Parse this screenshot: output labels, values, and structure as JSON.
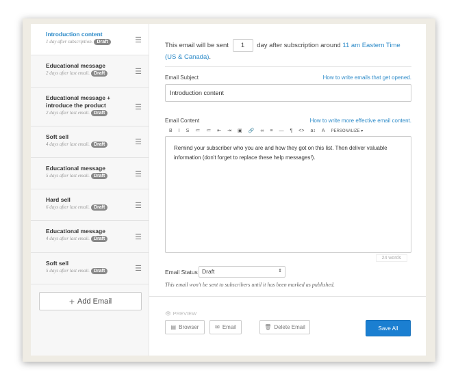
{
  "sidebar": {
    "items": [
      {
        "title": "Introduction content",
        "sub": "1 day after subscription.",
        "badge": "Draft"
      },
      {
        "title": "Educational message",
        "sub": "2 days after last email.",
        "badge": "Draft"
      },
      {
        "title": "Educational message + introduce the product",
        "sub": "2 days after last email.",
        "badge": "Draft"
      },
      {
        "title": "Soft sell",
        "sub": "4 days after last email.",
        "badge": "Draft"
      },
      {
        "title": "Educational message",
        "sub": "5 days after last email.",
        "badge": "Draft"
      },
      {
        "title": "Hard sell",
        "sub": "6 days after last email.",
        "badge": "Draft"
      },
      {
        "title": "Educational message",
        "sub": "4 days after last email.",
        "badge": "Draft"
      },
      {
        "title": "Soft sell",
        "sub": "5 days after last email.",
        "badge": "Draft"
      }
    ],
    "add_label": "Add Email"
  },
  "schedule": {
    "prefix": "This email will be sent",
    "days": "1",
    "middle": "day after subscription around",
    "time_link": "11 am Eastern Time (US & Canada)",
    "suffix": "."
  },
  "subject": {
    "label": "Email Subject",
    "help": "How to write emails that get opened.",
    "value": "Introduction content"
  },
  "content": {
    "label": "Email Content",
    "help": "How to write more effective email content.",
    "body": "Remind your subscriber who you are and how they got on this list. Then deliver valuable information (don't forget to replace these help messages!).",
    "word_count": "24 words",
    "toolbar": [
      "B",
      "I",
      "S",
      "≔",
      "≔",
      "⇤",
      "⇥",
      "▣",
      "🔗",
      "∞",
      "≡",
      "—",
      "¶",
      "<>",
      "a↕",
      "A"
    ],
    "personalize": "PERSONALIZE ▾"
  },
  "status": {
    "label": "Email Status",
    "value": "Draft",
    "note": "This email won't be sent to subscribers until it has been marked as published."
  },
  "footer": {
    "preview": "PREVIEW",
    "browser": "Browser",
    "email": "Email",
    "delete": "Delete Email",
    "save": "Save All"
  },
  "colors": {
    "accent": "#2c8ac8",
    "save": "#1b7fd1"
  }
}
